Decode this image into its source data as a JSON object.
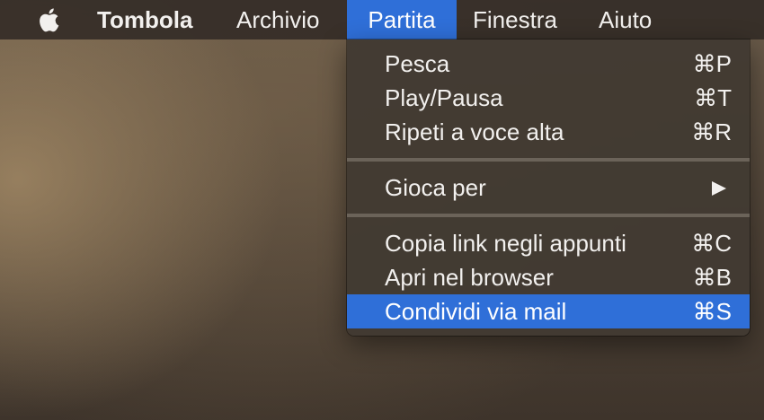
{
  "menubar": {
    "app_name": "Tombola",
    "menus": [
      "Archivio",
      "Partita",
      "Finestra",
      "Aiuto"
    ],
    "active_menu": "Partita",
    "apple_icon": "apple-logo-icon"
  },
  "dropdown": {
    "items": [
      {
        "label": "Pesca",
        "shortcut": "⌘P"
      },
      {
        "label": "Play/Pausa",
        "shortcut": "⌘T"
      },
      {
        "label": "Ripeti a voce alta",
        "shortcut": "⌘R"
      },
      {
        "label": "Gioca per",
        "submenu": true
      },
      {
        "label": "Copia link negli appunti",
        "shortcut": "⌘C"
      },
      {
        "label": "Apri nel browser",
        "shortcut": "⌘B"
      },
      {
        "label": "Condividi via mail",
        "shortcut": "⌘S",
        "highlighted": true
      }
    ]
  },
  "colors": {
    "highlight": "#2f6fd8",
    "menu_bg": "#423a32",
    "text": "#f2f0ee"
  }
}
